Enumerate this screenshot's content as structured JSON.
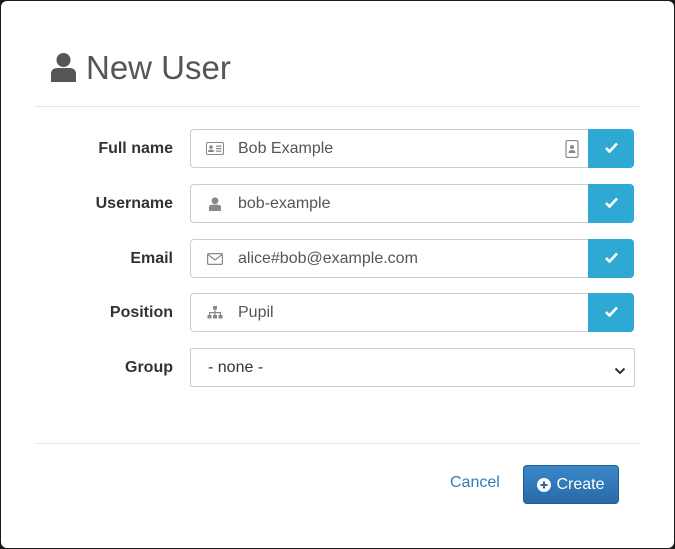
{
  "dialog": {
    "title": "New User"
  },
  "form": {
    "full_name": {
      "label": "Full name",
      "value": "Bob Example"
    },
    "username": {
      "label": "Username",
      "value": "bob-example"
    },
    "email": {
      "label": "Email",
      "value": "alice#bob@example.com"
    },
    "position": {
      "label": "Position",
      "value": "Pupil"
    },
    "group": {
      "label": "Group",
      "selected": "- none -"
    }
  },
  "footer": {
    "cancel_label": "Cancel",
    "create_label": "Create"
  },
  "colors": {
    "check_button": "#2ea9d4",
    "primary_button": "#2a6aa8",
    "link": "#337ab7"
  },
  "icons": {
    "title": "user-icon",
    "full_name": "id-card-icon",
    "username": "user-icon",
    "email": "envelope-icon",
    "position": "sitemap-icon",
    "check": "check-icon",
    "create": "plus-circle-icon",
    "contact_picker": "address-book-icon"
  }
}
